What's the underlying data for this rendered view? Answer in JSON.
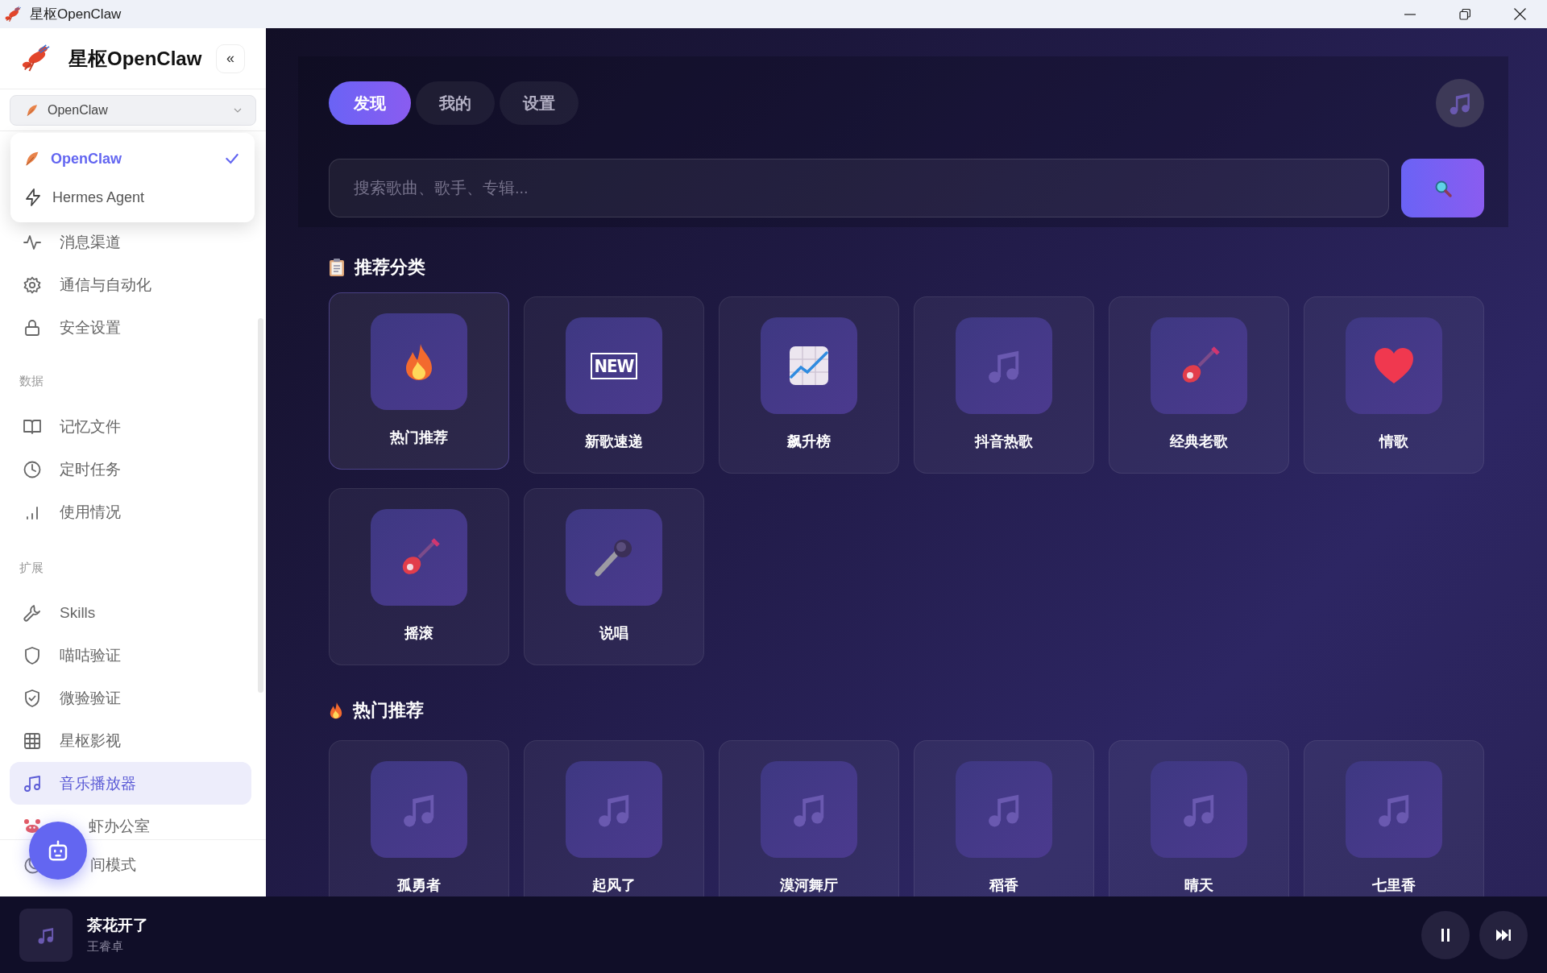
{
  "window": {
    "title": "星枢OpenClaw"
  },
  "sidebar": {
    "brand": "星枢OpenClaw",
    "collapse_button": "«",
    "agent_select": {
      "value": "OpenClaw"
    },
    "agent_menu": [
      {
        "label": "OpenClaw",
        "selected": true
      },
      {
        "label": "Hermes Agent",
        "selected": false
      }
    ],
    "nav_groups": [
      {
        "items": [
          {
            "label": "消息渠道",
            "selected": false
          },
          {
            "label": "通信与自动化",
            "selected": false
          },
          {
            "label": "安全设置",
            "selected": false
          }
        ]
      },
      {
        "title": "数据",
        "items": [
          {
            "label": "记忆文件",
            "selected": false
          },
          {
            "label": "定时任务",
            "selected": false
          },
          {
            "label": "使用情况",
            "selected": false
          }
        ]
      },
      {
        "title": "扩展",
        "items": [
          {
            "label": "Skills",
            "selected": false
          },
          {
            "label": "喵咕验证",
            "selected": false
          },
          {
            "label": "微验验证",
            "selected": false
          },
          {
            "label": "星枢影视",
            "selected": false
          },
          {
            "label": "音乐播放器",
            "selected": true
          },
          {
            "label": "虾办公室",
            "selected": false
          }
        ]
      }
    ],
    "footer_item": {
      "label": "间模式"
    }
  },
  "main": {
    "tabs": [
      {
        "label": "发现",
        "selected": true
      },
      {
        "label": "我的",
        "selected": false
      },
      {
        "label": "设置",
        "selected": false
      }
    ],
    "search": {
      "placeholder": "搜索歌曲、歌手、专辑..."
    },
    "categories": {
      "title": "推荐分类",
      "items": [
        {
          "label": "热门推荐",
          "selected": true
        },
        {
          "label": "新歌速递",
          "selected": false,
          "icon_text": "NEW"
        },
        {
          "label": "飙升榜",
          "selected": false
        },
        {
          "label": "抖音热歌",
          "selected": false
        },
        {
          "label": "经典老歌",
          "selected": false
        },
        {
          "label": "情歌",
          "selected": false
        },
        {
          "label": "摇滚",
          "selected": false
        },
        {
          "label": "说唱",
          "selected": false
        }
      ]
    },
    "hot": {
      "title": "热门推荐",
      "songs": [
        {
          "title": "孤勇者"
        },
        {
          "title": "起风了"
        },
        {
          "title": "漠河舞厅"
        },
        {
          "title": "稻香"
        },
        {
          "title": "晴天"
        },
        {
          "title": "七里香"
        }
      ]
    }
  },
  "player": {
    "title": "茶花开了",
    "artist": "王睿卓",
    "playing": true
  }
}
